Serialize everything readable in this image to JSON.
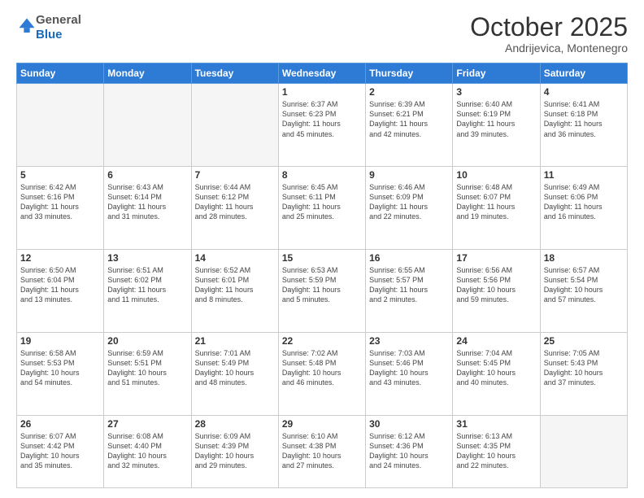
{
  "logo": {
    "general": "General",
    "blue": "Blue"
  },
  "header": {
    "month": "October 2025",
    "location": "Andrijevica, Montenegro"
  },
  "weekdays": [
    "Sunday",
    "Monday",
    "Tuesday",
    "Wednesday",
    "Thursday",
    "Friday",
    "Saturday"
  ],
  "days": [
    {
      "date": "",
      "info": ""
    },
    {
      "date": "",
      "info": ""
    },
    {
      "date": "",
      "info": ""
    },
    {
      "date": "1",
      "info": "Sunrise: 6:37 AM\nSunset: 6:23 PM\nDaylight: 11 hours\nand 45 minutes."
    },
    {
      "date": "2",
      "info": "Sunrise: 6:39 AM\nSunset: 6:21 PM\nDaylight: 11 hours\nand 42 minutes."
    },
    {
      "date": "3",
      "info": "Sunrise: 6:40 AM\nSunset: 6:19 PM\nDaylight: 11 hours\nand 39 minutes."
    },
    {
      "date": "4",
      "info": "Sunrise: 6:41 AM\nSunset: 6:18 PM\nDaylight: 11 hours\nand 36 minutes."
    },
    {
      "date": "5",
      "info": "Sunrise: 6:42 AM\nSunset: 6:16 PM\nDaylight: 11 hours\nand 33 minutes."
    },
    {
      "date": "6",
      "info": "Sunrise: 6:43 AM\nSunset: 6:14 PM\nDaylight: 11 hours\nand 31 minutes."
    },
    {
      "date": "7",
      "info": "Sunrise: 6:44 AM\nSunset: 6:12 PM\nDaylight: 11 hours\nand 28 minutes."
    },
    {
      "date": "8",
      "info": "Sunrise: 6:45 AM\nSunset: 6:11 PM\nDaylight: 11 hours\nand 25 minutes."
    },
    {
      "date": "9",
      "info": "Sunrise: 6:46 AM\nSunset: 6:09 PM\nDaylight: 11 hours\nand 22 minutes."
    },
    {
      "date": "10",
      "info": "Sunrise: 6:48 AM\nSunset: 6:07 PM\nDaylight: 11 hours\nand 19 minutes."
    },
    {
      "date": "11",
      "info": "Sunrise: 6:49 AM\nSunset: 6:06 PM\nDaylight: 11 hours\nand 16 minutes."
    },
    {
      "date": "12",
      "info": "Sunrise: 6:50 AM\nSunset: 6:04 PM\nDaylight: 11 hours\nand 13 minutes."
    },
    {
      "date": "13",
      "info": "Sunrise: 6:51 AM\nSunset: 6:02 PM\nDaylight: 11 hours\nand 11 minutes."
    },
    {
      "date": "14",
      "info": "Sunrise: 6:52 AM\nSunset: 6:01 PM\nDaylight: 11 hours\nand 8 minutes."
    },
    {
      "date": "15",
      "info": "Sunrise: 6:53 AM\nSunset: 5:59 PM\nDaylight: 11 hours\nand 5 minutes."
    },
    {
      "date": "16",
      "info": "Sunrise: 6:55 AM\nSunset: 5:57 PM\nDaylight: 11 hours\nand 2 minutes."
    },
    {
      "date": "17",
      "info": "Sunrise: 6:56 AM\nSunset: 5:56 PM\nDaylight: 10 hours\nand 59 minutes."
    },
    {
      "date": "18",
      "info": "Sunrise: 6:57 AM\nSunset: 5:54 PM\nDaylight: 10 hours\nand 57 minutes."
    },
    {
      "date": "19",
      "info": "Sunrise: 6:58 AM\nSunset: 5:53 PM\nDaylight: 10 hours\nand 54 minutes."
    },
    {
      "date": "20",
      "info": "Sunrise: 6:59 AM\nSunset: 5:51 PM\nDaylight: 10 hours\nand 51 minutes."
    },
    {
      "date": "21",
      "info": "Sunrise: 7:01 AM\nSunset: 5:49 PM\nDaylight: 10 hours\nand 48 minutes."
    },
    {
      "date": "22",
      "info": "Sunrise: 7:02 AM\nSunset: 5:48 PM\nDaylight: 10 hours\nand 46 minutes."
    },
    {
      "date": "23",
      "info": "Sunrise: 7:03 AM\nSunset: 5:46 PM\nDaylight: 10 hours\nand 43 minutes."
    },
    {
      "date": "24",
      "info": "Sunrise: 7:04 AM\nSunset: 5:45 PM\nDaylight: 10 hours\nand 40 minutes."
    },
    {
      "date": "25",
      "info": "Sunrise: 7:05 AM\nSunset: 5:43 PM\nDaylight: 10 hours\nand 37 minutes."
    },
    {
      "date": "26",
      "info": "Sunrise: 6:07 AM\nSunset: 4:42 PM\nDaylight: 10 hours\nand 35 minutes."
    },
    {
      "date": "27",
      "info": "Sunrise: 6:08 AM\nSunset: 4:40 PM\nDaylight: 10 hours\nand 32 minutes."
    },
    {
      "date": "28",
      "info": "Sunrise: 6:09 AM\nSunset: 4:39 PM\nDaylight: 10 hours\nand 29 minutes."
    },
    {
      "date": "29",
      "info": "Sunrise: 6:10 AM\nSunset: 4:38 PM\nDaylight: 10 hours\nand 27 minutes."
    },
    {
      "date": "30",
      "info": "Sunrise: 6:12 AM\nSunset: 4:36 PM\nDaylight: 10 hours\nand 24 minutes."
    },
    {
      "date": "31",
      "info": "Sunrise: 6:13 AM\nSunset: 4:35 PM\nDaylight: 10 hours\nand 22 minutes."
    },
    {
      "date": "",
      "info": ""
    }
  ]
}
